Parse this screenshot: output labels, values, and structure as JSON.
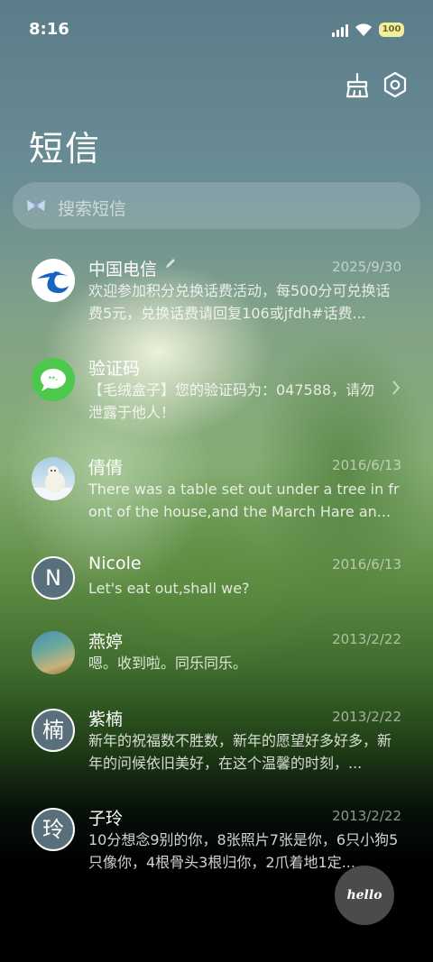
{
  "status_bar": {
    "time": "8:16",
    "battery": "100"
  },
  "header": {
    "title": "短信",
    "clean_icon": "broom-icon",
    "settings_icon": "settings-icon"
  },
  "search": {
    "placeholder": "搜索短信",
    "icon": "search-bow-icon"
  },
  "conversations": [
    {
      "name": "中国电信",
      "date": "2025/9/30",
      "preview": "欢迎参加积分兑换话费活动，每500分可兑换话费5元，兑换话费请回复106或jfdh#话费...",
      "avatar": "china-telecom-logo",
      "edit_icon": "pencil-icon"
    },
    {
      "name": "验证码",
      "date": "",
      "preview": "【毛绒盒子】您的验证码为：047588，请勿泄露于他人！",
      "avatar": "message-app-icon",
      "chevron_icon": "chevron-right-icon"
    },
    {
      "name": "倩倩",
      "date": "2016/6/13",
      "preview": "There was a table set out under a tree in front of the house,and the March Hare an...",
      "avatar": "polar-bear-photo"
    },
    {
      "name": "Nicole",
      "date": "2016/6/13",
      "preview": "Let's eat out,shall we?",
      "avatar_letter": "N"
    },
    {
      "name": "燕婷",
      "date": "2013/2/22",
      "preview": "嗯。收到啦。同乐同乐。",
      "avatar": "landscape-photo"
    },
    {
      "name": "紫楠",
      "date": "2013/2/22",
      "preview": "新年的祝福数不胜数，新年的愿望好多好多，新年的问候依旧美好，在这个温馨的时刻，...",
      "avatar_letter": "楠"
    },
    {
      "name": "子玲",
      "date": "2013/2/22",
      "preview": "10分想念9别的你，8张照片7张是你，6只小狗5只像你，4根骨头3根归你，2爪着地1定...",
      "avatar_letter": "玲"
    }
  ],
  "fab": {
    "label": "hello"
  }
}
